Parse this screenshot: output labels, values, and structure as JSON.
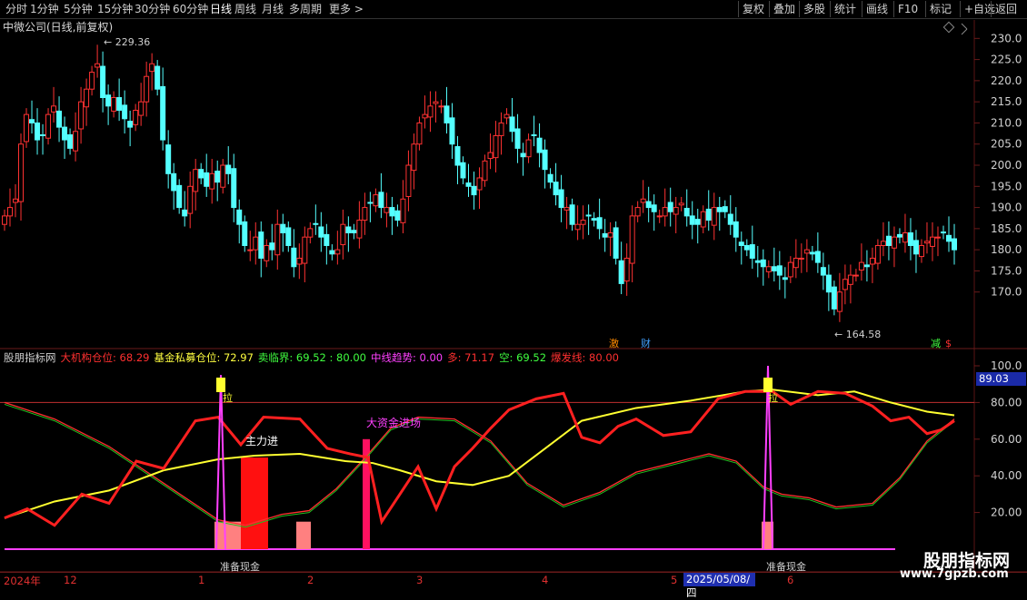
{
  "toolbar": {
    "periods": [
      "分时",
      "1分钟",
      "5分钟",
      "15分钟",
      "30分钟",
      "60分钟",
      "日线",
      "周线",
      "月线",
      "多周期",
      "更多 >"
    ],
    "active": "日线",
    "right": [
      "复权",
      "叠加",
      "多股",
      "统计",
      "画线",
      "F10",
      "标记",
      "+自选",
      "返回"
    ]
  },
  "main": {
    "title": "中微公司(日线,前复权)",
    "high_label": "229.36",
    "low_label": "164.58",
    "tag_ji": "激",
    "tag_cai": "财",
    "tag_jian": "减",
    "tag_s": "$",
    "y_ticks": [
      "230.0",
      "225.0",
      "220.0",
      "215.0",
      "210.0",
      "205.0",
      "200.0",
      "195.0",
      "190.0",
      "185.0",
      "180.0",
      "175.0",
      "170.0"
    ]
  },
  "sub": {
    "legend": [
      {
        "text": "股朋指标网",
        "color": "#d0d0d0"
      },
      {
        "text": "大机构仓位: 68.29",
        "color": "#ff3030"
      },
      {
        "text": "基金私募仓位: 72.97",
        "color": "#ffff40"
      },
      {
        "text": "卖临界: 69.52 : 80.00",
        "color": "#40ff40"
      },
      {
        "text": "中线趋势: 0.00",
        "color": "#ff40ff"
      },
      {
        "text": "多: 71.17",
        "color": "#ff3030"
      },
      {
        "text": "空: 69.52",
        "color": "#40ff40"
      },
      {
        "text": "爆发线: 80.00",
        "color": "#ff3030"
      }
    ],
    "current_value": "89.03",
    "y_ticks": [
      "100.0",
      "80.00",
      "60.00",
      "40.00",
      "20.00"
    ],
    "annot_zhulijin": "主力进",
    "annot_dazijin": "大资金进场",
    "annot_zhunbei1": "准备现金",
    "annot_zhunbei2": "准备现金",
    "annot_la": "拉"
  },
  "xaxis": {
    "labels": [
      "2024年",
      "12",
      "1",
      "2",
      "3",
      "4",
      "5",
      "6"
    ],
    "cursor_date": "2025/05/08/四"
  },
  "watermark": {
    "title": "股朋指标网",
    "url": "www.7gpzb.com"
  },
  "colors": {
    "up": "#ff3232",
    "down": "#54ffff",
    "axis": "#5a1414"
  },
  "chart_data": {
    "type": "candlestick",
    "title": "中微公司(日线,前复权)",
    "ylim": [
      165,
      232
    ],
    "high": 229.36,
    "low": 164.58,
    "close_series": [
      188,
      190,
      192,
      205,
      212,
      210,
      206,
      207,
      212,
      214,
      209,
      206,
      204,
      208,
      215,
      218,
      222,
      224,
      216,
      214,
      216,
      213,
      211,
      209,
      213,
      215,
      221,
      224,
      218,
      206,
      198,
      194,
      190,
      188,
      195,
      199,
      197,
      195,
      198,
      196,
      200,
      198,
      190,
      186,
      181,
      180,
      183,
      178,
      181,
      180,
      186,
      184,
      181,
      176,
      178,
      183,
      185,
      186,
      183,
      181,
      179,
      180,
      186,
      184,
      184,
      187,
      190,
      191,
      193,
      190,
      190,
      188,
      187,
      192,
      200,
      205,
      210,
      212,
      214,
      215,
      214,
      210,
      205,
      200,
      197,
      195,
      193,
      197,
      201,
      203,
      207,
      210,
      212,
      208,
      204,
      202,
      206,
      207,
      203,
      199,
      196,
      193,
      190,
      190,
      186,
      186,
      187,
      188,
      187,
      185,
      183,
      184,
      178,
      172,
      178,
      188,
      190,
      192,
      190,
      189,
      188,
      190,
      189,
      190,
      191,
      188,
      186,
      186,
      189,
      187,
      190,
      189,
      189,
      186,
      183,
      181,
      180,
      178,
      177,
      176,
      176,
      175,
      174,
      173,
      177,
      178,
      178,
      180,
      179,
      177,
      174,
      170,
      166,
      170,
      173,
      174,
      174,
      177,
      176,
      178,
      181,
      182,
      181,
      183,
      183,
      184,
      181,
      179,
      181,
      182,
      183,
      183,
      184,
      182,
      180
    ]
  }
}
